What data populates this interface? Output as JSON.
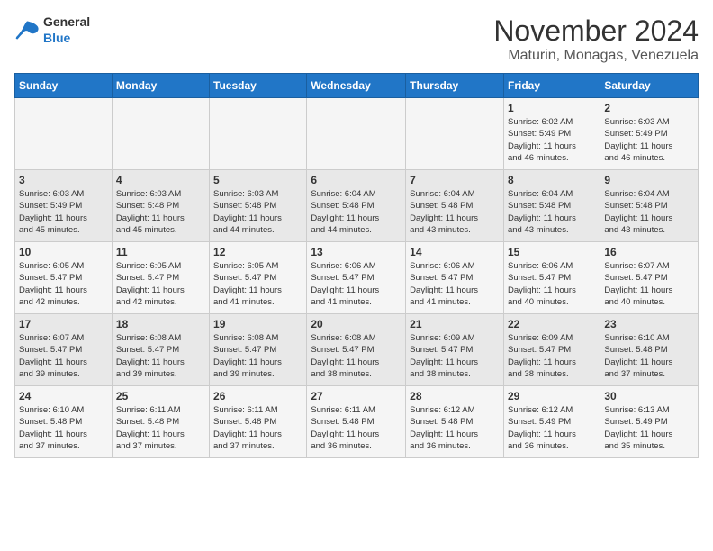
{
  "header": {
    "title": "November 2024",
    "location": "Maturin, Monagas, Venezuela",
    "logo_general": "General",
    "logo_blue": "Blue"
  },
  "days_of_week": [
    "Sunday",
    "Monday",
    "Tuesday",
    "Wednesday",
    "Thursday",
    "Friday",
    "Saturday"
  ],
  "weeks": [
    [
      {
        "day": "",
        "info": ""
      },
      {
        "day": "",
        "info": ""
      },
      {
        "day": "",
        "info": ""
      },
      {
        "day": "",
        "info": ""
      },
      {
        "day": "",
        "info": ""
      },
      {
        "day": "1",
        "info": "Sunrise: 6:02 AM\nSunset: 5:49 PM\nDaylight: 11 hours\nand 46 minutes."
      },
      {
        "day": "2",
        "info": "Sunrise: 6:03 AM\nSunset: 5:49 PM\nDaylight: 11 hours\nand 46 minutes."
      }
    ],
    [
      {
        "day": "3",
        "info": "Sunrise: 6:03 AM\nSunset: 5:49 PM\nDaylight: 11 hours\nand 45 minutes."
      },
      {
        "day": "4",
        "info": "Sunrise: 6:03 AM\nSunset: 5:48 PM\nDaylight: 11 hours\nand 45 minutes."
      },
      {
        "day": "5",
        "info": "Sunrise: 6:03 AM\nSunset: 5:48 PM\nDaylight: 11 hours\nand 44 minutes."
      },
      {
        "day": "6",
        "info": "Sunrise: 6:04 AM\nSunset: 5:48 PM\nDaylight: 11 hours\nand 44 minutes."
      },
      {
        "day": "7",
        "info": "Sunrise: 6:04 AM\nSunset: 5:48 PM\nDaylight: 11 hours\nand 43 minutes."
      },
      {
        "day": "8",
        "info": "Sunrise: 6:04 AM\nSunset: 5:48 PM\nDaylight: 11 hours\nand 43 minutes."
      },
      {
        "day": "9",
        "info": "Sunrise: 6:04 AM\nSunset: 5:48 PM\nDaylight: 11 hours\nand 43 minutes."
      }
    ],
    [
      {
        "day": "10",
        "info": "Sunrise: 6:05 AM\nSunset: 5:47 PM\nDaylight: 11 hours\nand 42 minutes."
      },
      {
        "day": "11",
        "info": "Sunrise: 6:05 AM\nSunset: 5:47 PM\nDaylight: 11 hours\nand 42 minutes."
      },
      {
        "day": "12",
        "info": "Sunrise: 6:05 AM\nSunset: 5:47 PM\nDaylight: 11 hours\nand 41 minutes."
      },
      {
        "day": "13",
        "info": "Sunrise: 6:06 AM\nSunset: 5:47 PM\nDaylight: 11 hours\nand 41 minutes."
      },
      {
        "day": "14",
        "info": "Sunrise: 6:06 AM\nSunset: 5:47 PM\nDaylight: 11 hours\nand 41 minutes."
      },
      {
        "day": "15",
        "info": "Sunrise: 6:06 AM\nSunset: 5:47 PM\nDaylight: 11 hours\nand 40 minutes."
      },
      {
        "day": "16",
        "info": "Sunrise: 6:07 AM\nSunset: 5:47 PM\nDaylight: 11 hours\nand 40 minutes."
      }
    ],
    [
      {
        "day": "17",
        "info": "Sunrise: 6:07 AM\nSunset: 5:47 PM\nDaylight: 11 hours\nand 39 minutes."
      },
      {
        "day": "18",
        "info": "Sunrise: 6:08 AM\nSunset: 5:47 PM\nDaylight: 11 hours\nand 39 minutes."
      },
      {
        "day": "19",
        "info": "Sunrise: 6:08 AM\nSunset: 5:47 PM\nDaylight: 11 hours\nand 39 minutes."
      },
      {
        "day": "20",
        "info": "Sunrise: 6:08 AM\nSunset: 5:47 PM\nDaylight: 11 hours\nand 38 minutes."
      },
      {
        "day": "21",
        "info": "Sunrise: 6:09 AM\nSunset: 5:47 PM\nDaylight: 11 hours\nand 38 minutes."
      },
      {
        "day": "22",
        "info": "Sunrise: 6:09 AM\nSunset: 5:47 PM\nDaylight: 11 hours\nand 38 minutes."
      },
      {
        "day": "23",
        "info": "Sunrise: 6:10 AM\nSunset: 5:48 PM\nDaylight: 11 hours\nand 37 minutes."
      }
    ],
    [
      {
        "day": "24",
        "info": "Sunrise: 6:10 AM\nSunset: 5:48 PM\nDaylight: 11 hours\nand 37 minutes."
      },
      {
        "day": "25",
        "info": "Sunrise: 6:11 AM\nSunset: 5:48 PM\nDaylight: 11 hours\nand 37 minutes."
      },
      {
        "day": "26",
        "info": "Sunrise: 6:11 AM\nSunset: 5:48 PM\nDaylight: 11 hours\nand 37 minutes."
      },
      {
        "day": "27",
        "info": "Sunrise: 6:11 AM\nSunset: 5:48 PM\nDaylight: 11 hours\nand 36 minutes."
      },
      {
        "day": "28",
        "info": "Sunrise: 6:12 AM\nSunset: 5:48 PM\nDaylight: 11 hours\nand 36 minutes."
      },
      {
        "day": "29",
        "info": "Sunrise: 6:12 AM\nSunset: 5:49 PM\nDaylight: 11 hours\nand 36 minutes."
      },
      {
        "day": "30",
        "info": "Sunrise: 6:13 AM\nSunset: 5:49 PM\nDaylight: 11 hours\nand 35 minutes."
      }
    ]
  ]
}
